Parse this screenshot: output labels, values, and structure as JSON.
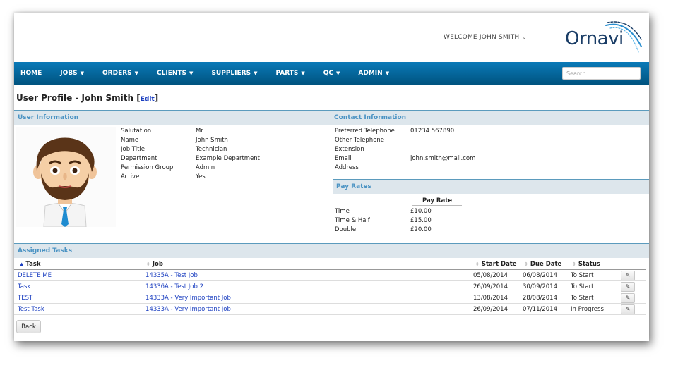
{
  "header": {
    "welcome": "WELCOME JOHN SMITH",
    "logo_text": "Ornavi"
  },
  "nav": {
    "items": [
      {
        "label": "HOME",
        "dropdown": false
      },
      {
        "label": "JOBS",
        "dropdown": true
      },
      {
        "label": "ORDERS",
        "dropdown": true
      },
      {
        "label": "CLIENTS",
        "dropdown": true
      },
      {
        "label": "SUPPLIERS",
        "dropdown": true
      },
      {
        "label": "PARTS",
        "dropdown": true
      },
      {
        "label": "QC",
        "dropdown": true
      },
      {
        "label": "ADMIN",
        "dropdown": true
      }
    ],
    "search_placeholder": "Search..."
  },
  "page": {
    "title": "User Profile - John Smith",
    "edit_label": "Edit"
  },
  "user_info": {
    "heading": "User Information",
    "fields": [
      {
        "label": "Salutation",
        "value": "Mr"
      },
      {
        "label": "Name",
        "value": "John Smith"
      },
      {
        "label": "Job Title",
        "value": "Technician"
      },
      {
        "label": "Department",
        "value": "Example Department"
      },
      {
        "label": "Permission Group",
        "value": "Admin"
      },
      {
        "label": "Active",
        "value": "Yes"
      }
    ]
  },
  "contact_info": {
    "heading": "Contact Information",
    "fields": [
      {
        "label": "Preferred Telephone",
        "value": "01234 567890"
      },
      {
        "label": "Other Telephone",
        "value": ""
      },
      {
        "label": "Extension",
        "value": ""
      },
      {
        "label": "Email",
        "value": "john.smith@mail.com"
      },
      {
        "label": "Address",
        "value": ""
      }
    ]
  },
  "pay_rates": {
    "heading": "Pay Rates",
    "column": "Pay Rate",
    "rows": [
      {
        "label": "Time",
        "value": "£10.00"
      },
      {
        "label": "Time & Half",
        "value": "£15.00"
      },
      {
        "label": "Double",
        "value": "£20.00"
      }
    ]
  },
  "tasks": {
    "heading": "Assigned Tasks",
    "columns": [
      "Task",
      "Job",
      "Start Date",
      "Due Date",
      "Status"
    ],
    "rows": [
      {
        "task": "DELETE ME",
        "job": "14335A - Test Job",
        "start": "05/08/2014",
        "due": "06/08/2014",
        "status": "To Start"
      },
      {
        "task": "Task",
        "job": "14336A - Test Job 2",
        "start": "26/09/2014",
        "due": "30/09/2014",
        "status": "To Start"
      },
      {
        "task": "TEST",
        "job": "14333A - Very Important Job",
        "start": "13/08/2014",
        "due": "28/08/2014",
        "status": "To Start"
      },
      {
        "task": "Test Task",
        "job": "14333A - Very Important Job",
        "start": "26/09/2014",
        "due": "07/11/2014",
        "status": "In Progress"
      }
    ],
    "back_label": "Back"
  },
  "colors": {
    "nav_top": "#0a7ab8",
    "nav_bottom": "#00537f",
    "section_text": "#4b93c3",
    "link": "#1a3ec0",
    "logo": "#1a3d66"
  }
}
